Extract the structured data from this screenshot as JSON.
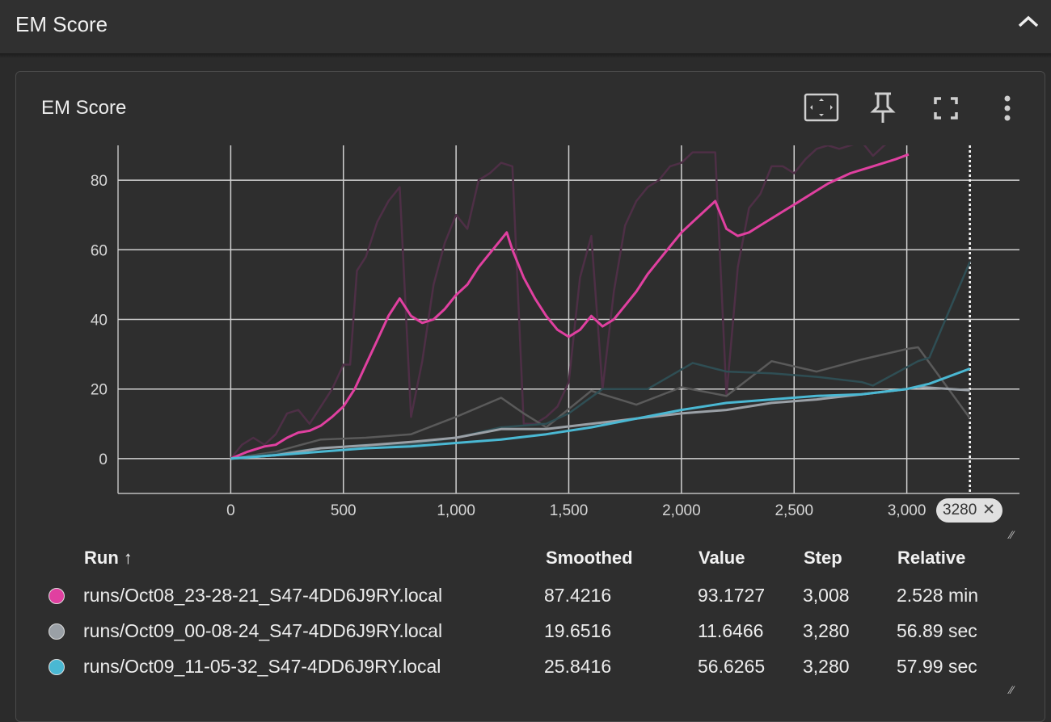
{
  "section": {
    "title": "EM Score"
  },
  "card": {
    "title": "EM Score"
  },
  "toolbar": {
    "fit_icon": "fit-to-data-icon",
    "pin_icon": "pin-icon",
    "fullscreen_icon": "fullscreen-icon",
    "more_icon": "more-vert-icon"
  },
  "chart_data": {
    "type": "line",
    "title": "EM Score",
    "xlabel": "",
    "ylabel": "",
    "xlim": [
      -500,
      3500
    ],
    "ylim": [
      -10,
      90
    ],
    "x_ticks": [
      0,
      500,
      1000,
      1500,
      2000,
      2500,
      3000
    ],
    "x_tick_labels": [
      "0",
      "500",
      "1,000",
      "1,500",
      "2,000",
      "2,500",
      "3,000"
    ],
    "y_ticks": [
      0,
      20,
      40,
      60,
      80
    ],
    "y_tick_labels": [
      "0",
      "20",
      "40",
      "60",
      "80"
    ],
    "grid": true,
    "cursor_step": 3280,
    "cursor_label": "3280",
    "series": [
      {
        "name": "runs/Oct08_23-28-21_S47-4DD6J9RY.local",
        "color": "#e040a0",
        "raw_color": "#4e2f46",
        "smoothed": [
          [
            0,
            0
          ],
          [
            75,
            2
          ],
          [
            150,
            3.5
          ],
          [
            200,
            4
          ],
          [
            250,
            6
          ],
          [
            300,
            7.5
          ],
          [
            350,
            8
          ],
          [
            400,
            9.5
          ],
          [
            450,
            12
          ],
          [
            500,
            15
          ],
          [
            550,
            20
          ],
          [
            600,
            27
          ],
          [
            650,
            34
          ],
          [
            700,
            41
          ],
          [
            750,
            46
          ],
          [
            800,
            41
          ],
          [
            850,
            39
          ],
          [
            900,
            40
          ],
          [
            950,
            43
          ],
          [
            1000,
            47
          ],
          [
            1050,
            50
          ],
          [
            1100,
            55
          ],
          [
            1150,
            59
          ],
          [
            1200,
            63
          ],
          [
            1225,
            65
          ],
          [
            1250,
            60
          ],
          [
            1300,
            52
          ],
          [
            1350,
            46
          ],
          [
            1400,
            41
          ],
          [
            1450,
            37
          ],
          [
            1500,
            35
          ],
          [
            1550,
            37
          ],
          [
            1600,
            41
          ],
          [
            1650,
            38
          ],
          [
            1700,
            40
          ],
          [
            1750,
            44
          ],
          [
            1800,
            48
          ],
          [
            1850,
            53
          ],
          [
            1900,
            57
          ],
          [
            1950,
            61
          ],
          [
            2000,
            65
          ],
          [
            2050,
            68
          ],
          [
            2100,
            71
          ],
          [
            2150,
            74
          ],
          [
            2200,
            66
          ],
          [
            2250,
            64
          ],
          [
            2300,
            65
          ],
          [
            2350,
            67
          ],
          [
            2400,
            69
          ],
          [
            2450,
            71
          ],
          [
            2500,
            73
          ],
          [
            2550,
            75
          ],
          [
            2600,
            77
          ],
          [
            2650,
            79
          ],
          [
            2700,
            80.5
          ],
          [
            2750,
            82
          ],
          [
            2800,
            83
          ],
          [
            2850,
            84
          ],
          [
            2900,
            85
          ],
          [
            2950,
            86
          ],
          [
            3008,
            87.4
          ]
        ],
        "raw": [
          [
            0,
            0
          ],
          [
            50,
            4
          ],
          [
            100,
            6
          ],
          [
            150,
            4
          ],
          [
            200,
            7
          ],
          [
            250,
            13
          ],
          [
            300,
            14
          ],
          [
            350,
            10
          ],
          [
            400,
            15
          ],
          [
            450,
            20
          ],
          [
            500,
            27
          ],
          [
            530,
            27
          ],
          [
            560,
            54
          ],
          [
            600,
            58
          ],
          [
            650,
            68
          ],
          [
            700,
            74
          ],
          [
            750,
            78
          ],
          [
            800,
            12
          ],
          [
            850,
            28
          ],
          [
            900,
            50
          ],
          [
            950,
            62
          ],
          [
            1000,
            70
          ],
          [
            1050,
            66
          ],
          [
            1100,
            80
          ],
          [
            1150,
            82
          ],
          [
            1200,
            85
          ],
          [
            1250,
            84
          ],
          [
            1300,
            10
          ],
          [
            1350,
            10
          ],
          [
            1400,
            12
          ],
          [
            1450,
            15
          ],
          [
            1500,
            22
          ],
          [
            1550,
            52
          ],
          [
            1600,
            64
          ],
          [
            1650,
            20
          ],
          [
            1700,
            48
          ],
          [
            1750,
            67
          ],
          [
            1800,
            74
          ],
          [
            1850,
            78
          ],
          [
            1900,
            80
          ],
          [
            1950,
            84
          ],
          [
            2000,
            85
          ],
          [
            2050,
            88
          ],
          [
            2100,
            88
          ],
          [
            2150,
            88
          ],
          [
            2200,
            18
          ],
          [
            2250,
            55
          ],
          [
            2300,
            72
          ],
          [
            2350,
            76
          ],
          [
            2400,
            84
          ],
          [
            2450,
            84
          ],
          [
            2500,
            82
          ],
          [
            2550,
            86
          ],
          [
            2600,
            89
          ],
          [
            2650,
            90
          ],
          [
            2700,
            89
          ],
          [
            2750,
            90
          ],
          [
            2800,
            91
          ],
          [
            2850,
            87
          ],
          [
            2900,
            90
          ],
          [
            2950,
            92
          ],
          [
            3008,
            93.2
          ]
        ]
      },
      {
        "name": "runs/Oct09_00-08-24_S47-4DD6J9RY.local",
        "color": "#9aa0a6",
        "raw_color": "#5a5a5a",
        "smoothed": [
          [
            0,
            0
          ],
          [
            200,
            1
          ],
          [
            400,
            3
          ],
          [
            600,
            3.8
          ],
          [
            800,
            4.8
          ],
          [
            1000,
            6
          ],
          [
            1200,
            8.5
          ],
          [
            1400,
            8.5
          ],
          [
            1600,
            10
          ],
          [
            1800,
            11.5
          ],
          [
            2000,
            13
          ],
          [
            2200,
            14
          ],
          [
            2400,
            16
          ],
          [
            2600,
            17
          ],
          [
            2800,
            18.5
          ],
          [
            3000,
            20
          ],
          [
            3050,
            20.6
          ],
          [
            3280,
            19.65
          ]
        ],
        "raw": [
          [
            0,
            0
          ],
          [
            200,
            2
          ],
          [
            400,
            5.5
          ],
          [
            600,
            6
          ],
          [
            800,
            7
          ],
          [
            1000,
            12
          ],
          [
            1200,
            17.5
          ],
          [
            1300,
            13
          ],
          [
            1400,
            9
          ],
          [
            1600,
            19.5
          ],
          [
            1800,
            15.5
          ],
          [
            2000,
            20.5
          ],
          [
            2200,
            18
          ],
          [
            2400,
            28
          ],
          [
            2600,
            25
          ],
          [
            2800,
            28.5
          ],
          [
            3000,
            31.5
          ],
          [
            3050,
            32
          ],
          [
            3280,
            11.6
          ]
        ]
      },
      {
        "name": "runs/Oct09_11-05-32_S47-4DD6J9RY.local",
        "color": "#4ab8d3",
        "raw_color": "#2f4e54",
        "smoothed": [
          [
            0,
            0
          ],
          [
            200,
            1
          ],
          [
            400,
            2
          ],
          [
            600,
            3
          ],
          [
            800,
            3.5
          ],
          [
            1000,
            4.5
          ],
          [
            1200,
            5.5
          ],
          [
            1400,
            7
          ],
          [
            1600,
            9
          ],
          [
            1800,
            11.5
          ],
          [
            2000,
            14
          ],
          [
            2200,
            16
          ],
          [
            2400,
            17
          ],
          [
            2600,
            18
          ],
          [
            2800,
            18.5
          ],
          [
            3000,
            20
          ],
          [
            3100,
            21.5
          ],
          [
            3280,
            25.84
          ]
        ],
        "raw": [
          [
            0,
            0
          ],
          [
            200,
            1.5
          ],
          [
            400,
            3
          ],
          [
            600,
            4
          ],
          [
            800,
            4
          ],
          [
            1000,
            6
          ],
          [
            1200,
            9
          ],
          [
            1400,
            10
          ],
          [
            1500,
            13
          ],
          [
            1650,
            20
          ],
          [
            1850,
            20
          ],
          [
            2050,
            27.5
          ],
          [
            2200,
            25
          ],
          [
            2400,
            24.5
          ],
          [
            2600,
            23.5
          ],
          [
            2800,
            22
          ],
          [
            2850,
            21
          ],
          [
            3050,
            28
          ],
          [
            3100,
            29
          ],
          [
            3280,
            56.6
          ]
        ]
      }
    ]
  },
  "table": {
    "headers": {
      "run": "Run ↑",
      "smoothed": "Smoothed",
      "value": "Value",
      "step": "Step",
      "relative": "Relative"
    },
    "rows": [
      {
        "run": "runs/Oct08_23-28-21_S47-4DD6J9RY.local",
        "smoothed": "87.4216",
        "value": "93.1727",
        "step": "3,008",
        "relative": "2.528 min",
        "color": "#e040a0"
      },
      {
        "run": "runs/Oct09_00-08-24_S47-4DD6J9RY.local",
        "smoothed": "19.6516",
        "value": "11.6466",
        "step": "3,280",
        "relative": "56.89 sec",
        "color": "#9aa0a6"
      },
      {
        "run": "runs/Oct09_11-05-32_S47-4DD6J9RY.local",
        "smoothed": "25.8416",
        "value": "56.6265",
        "step": "3,280",
        "relative": "57.99 sec",
        "color": "#4ab8d3"
      }
    ]
  }
}
